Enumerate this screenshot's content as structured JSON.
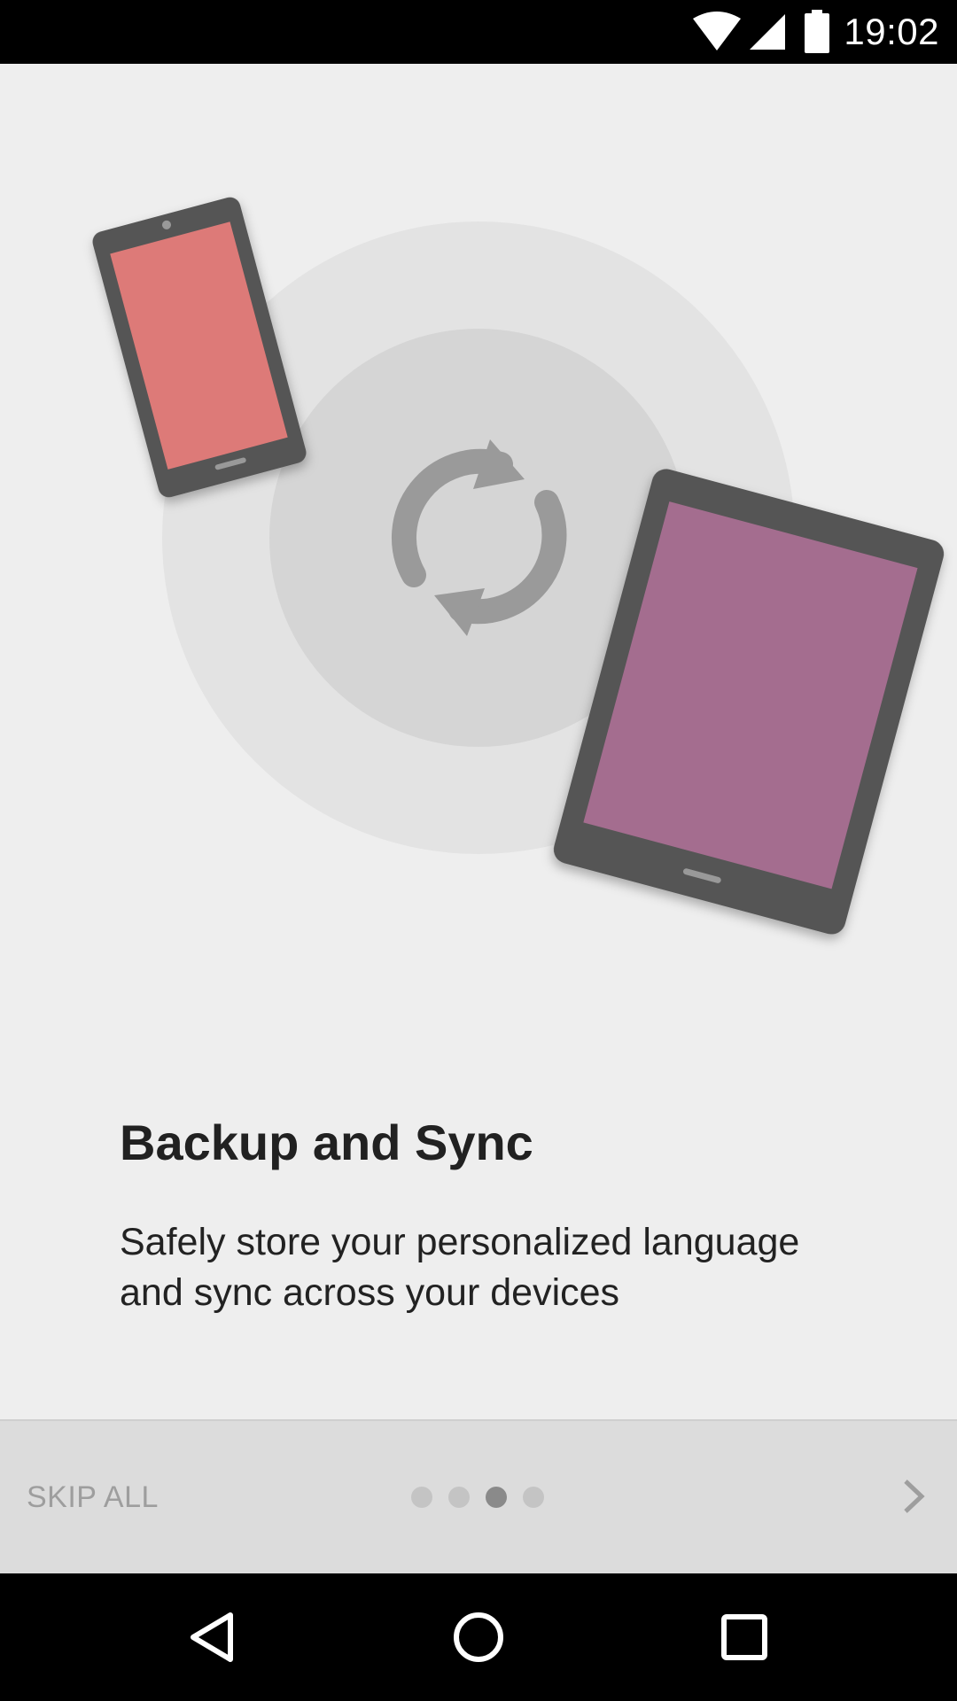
{
  "status_bar": {
    "time": "19:02",
    "icons": [
      "wifi-icon",
      "cell-signal-icon",
      "battery-icon"
    ]
  },
  "onboarding": {
    "title": "Backup and Sync",
    "description_lines": [
      "Safely store your personalized language",
      "and sync across your devices"
    ],
    "illustration": {
      "icons": [
        "phone-icon",
        "tablet-icon",
        "sync-icon"
      ],
      "colors": {
        "phone_screen": "#e57c7a",
        "tablet_screen": "#a96f92",
        "device_frame": "#555555",
        "sync_icon": "#9a9a9a"
      }
    }
  },
  "footer": {
    "skip_label": "SKIP ALL",
    "page_count": 4,
    "current_page": 3,
    "next_icon": "chevron-right-icon"
  },
  "nav_bar": {
    "icons": [
      "back-icon",
      "home-icon",
      "recents-icon"
    ]
  },
  "colors": {
    "background": "#eeeeee",
    "footer_background": "#dcdcdc",
    "title_text": "#212121",
    "skip_text": "#9e9e9e"
  }
}
